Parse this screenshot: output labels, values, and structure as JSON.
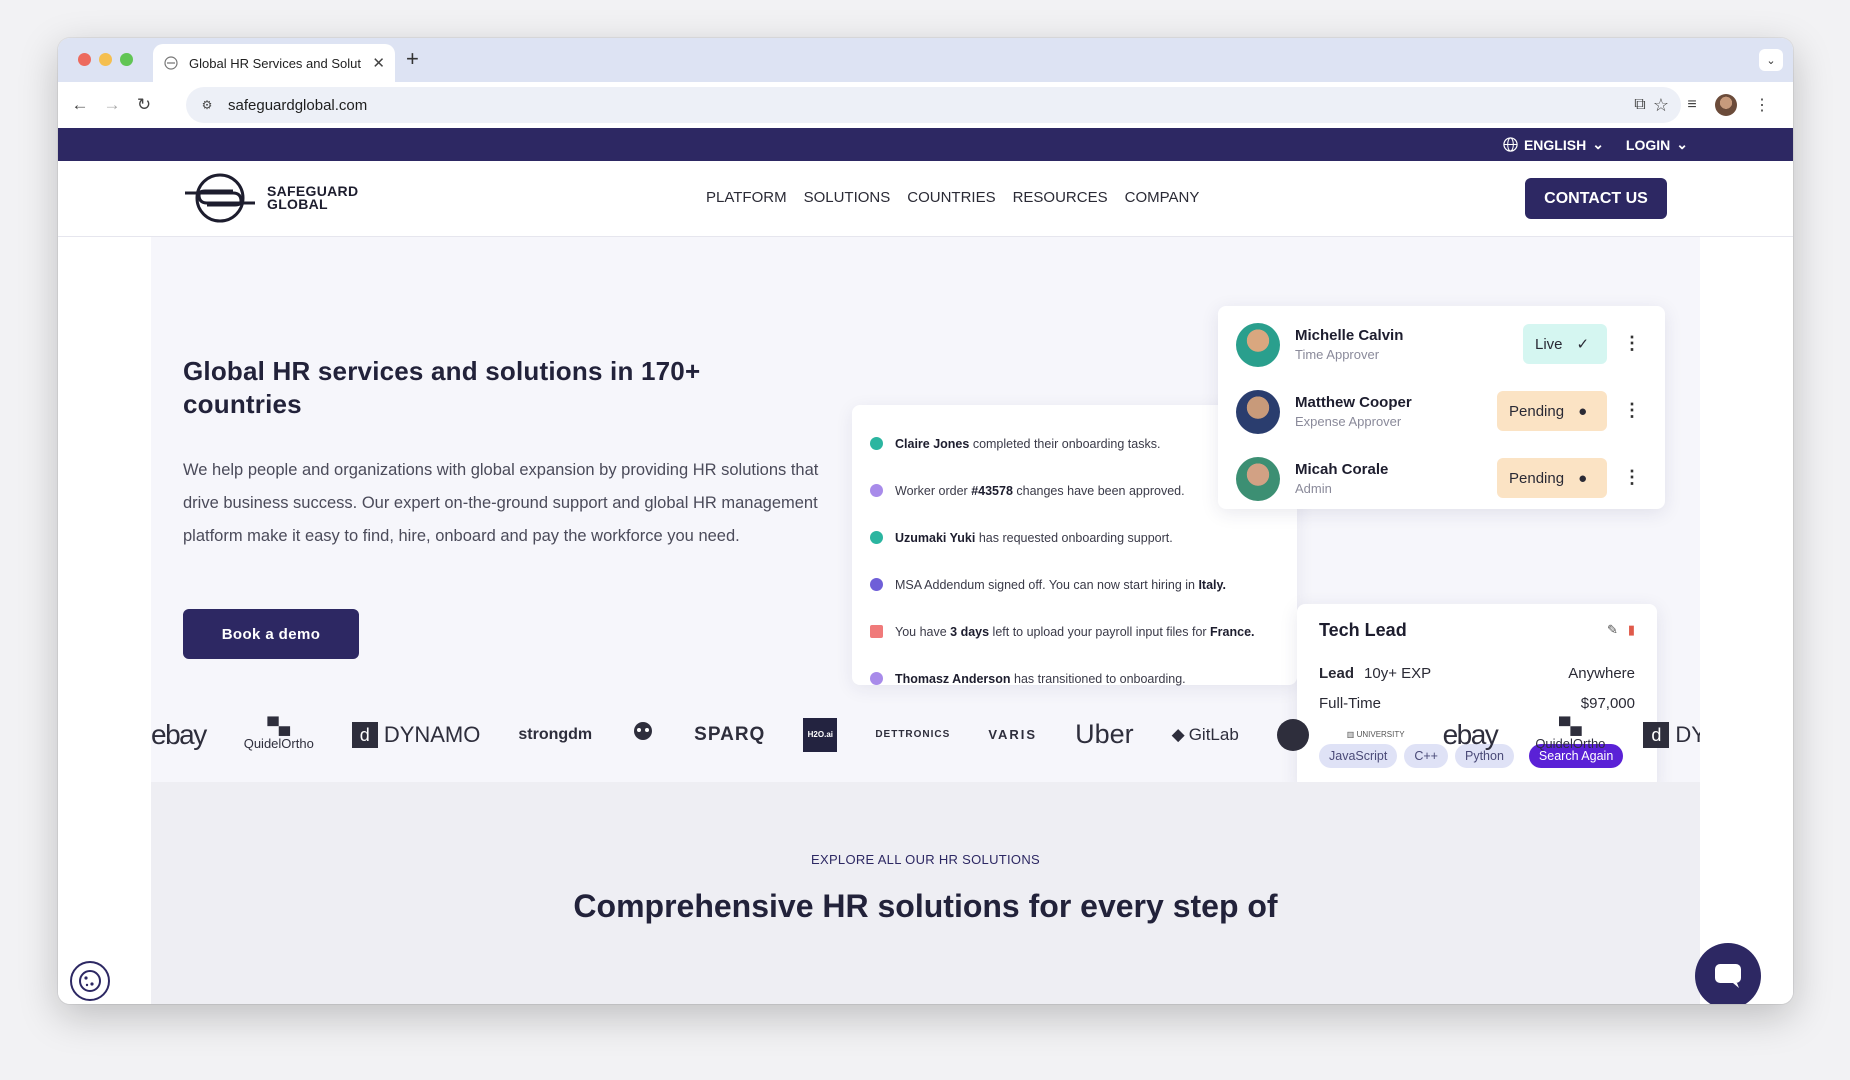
{
  "browser": {
    "tab_title": "Global HR Services and Solut",
    "url": "safeguardglobal.com"
  },
  "utility": {
    "language": "ENGLISH",
    "login": "LOGIN"
  },
  "header": {
    "logo_line1": "SAFEGUARD",
    "logo_line2": "GLOBAL",
    "nav": [
      "PLATFORM",
      "SOLUTIONS",
      "COUNTRIES",
      "RESOURCES",
      "COMPANY"
    ],
    "contact": "CONTACT US"
  },
  "hero": {
    "title": "Global HR services and solutions in 170+ countries",
    "body": "We help people and organizations with global expansion by providing HR solutions that drive business success. Our expert on-the-ground support and global HR management platform make it easy to find, hire, onboard and pay the workforce you need.",
    "cta": "Book a demo"
  },
  "activity": [
    {
      "bold": "Claire Jones",
      "text": " completed their onboarding tasks.",
      "color": "#2bb5a0"
    },
    {
      "pre": "Worker order ",
      "bold": "#43578",
      "text": " changes have been approved.",
      "color": "#a88bea"
    },
    {
      "bold": "Uzumaki Yuki",
      "text": " has requested onboarding support.",
      "color": "#2bb5a0"
    },
    {
      "pre": "MSA Addendum signed off. You can now start hiring in ",
      "bold": "Italy.",
      "text": "",
      "color": "#6f5fd8"
    },
    {
      "pre": "You have ",
      "bold": "3 days",
      "text": " left to upload your payroll input files for ",
      "bold2": "France.",
      "color": "#f07a7a"
    },
    {
      "bold": "Thomasz Anderson",
      "text": " has transitioned to onboarding.",
      "color": "#a88bea"
    }
  ],
  "approvers": [
    {
      "name": "Michelle Calvin",
      "role": "Time Approver",
      "status": "Live"
    },
    {
      "name": "Matthew Cooper",
      "role": "Expense Approver",
      "status": "Pending"
    },
    {
      "name": "Micah Corale",
      "role": "Admin",
      "status": "Pending"
    }
  ],
  "job": {
    "title": "Tech Lead",
    "level": "Lead",
    "exp": "10y+ EXP",
    "location": "Anywhere",
    "type": "Full-Time",
    "salary": "$97,000",
    "tags": [
      "JavaScript",
      "C++",
      "Python"
    ],
    "action": "Search Again"
  },
  "logos": [
    "ebay",
    "QuidelOrtho",
    "DYNAMO",
    "strongdm",
    "WWF",
    "SPARQ",
    "H2O.ai",
    "DETTRONICS",
    "VARIS",
    "Uber",
    "GitLab",
    "ebay",
    "QuidelOrtho",
    "DY"
  ],
  "solutions": {
    "kicker": "EXPLORE ALL OUR HR SOLUTIONS",
    "title": "Comprehensive HR solutions for every step of"
  },
  "colors": {
    "brand": "#2d2863",
    "accent": "#5a21d6"
  }
}
